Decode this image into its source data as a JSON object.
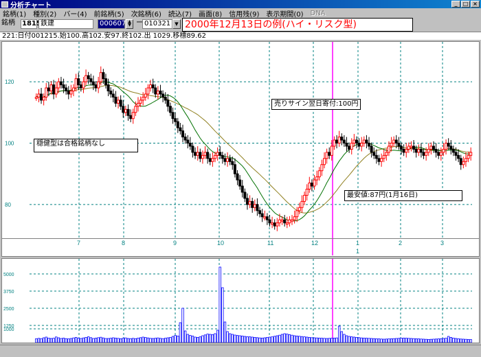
{
  "window": {
    "title": "分析チャート",
    "controls": {
      "minimize": "_",
      "maximize": "□",
      "close": "×"
    }
  },
  "menu": {
    "items": [
      "銘柄(1)",
      "種別(2)",
      "バー(4)",
      "前銘柄(5)",
      "次銘柄(6)",
      "読込(7)",
      "画面(8)",
      "信用残(9)",
      "表示期間(0)"
    ],
    "disabled_item": "DNA"
  },
  "toolbar": {
    "label": "銘柄",
    "code": "1815",
    "name": "鉄建",
    "start_date": "000607",
    "end_date": "010321",
    "separator": "ー"
  },
  "annotation_title": "2000年12月13日の例(ハイ・リスク型)",
  "info_line": "221:日付001215.始100.高102.安97.終102.出 1029.移標89.62",
  "colors": {
    "up_candle": "#ff0000",
    "down_candle": "#000000",
    "ma_short": "#007000",
    "ma_long": "#908020",
    "signal_line": "#ff40ff",
    "volume_bar": "#0000ff",
    "grid": "#008080"
  },
  "callouts": {
    "sell_signal": "売りサイン翌日寄付:100円",
    "stable_note": "穏健型は合格銘柄なし",
    "lowest_price": "最安値:87円(1月16日)"
  },
  "chart_data": {
    "type": "candlestick",
    "price_axis": {
      "ticks": [
        120,
        100,
        80
      ],
      "ylim": [
        69,
        133
      ]
    },
    "volume_axis": {
      "ticks": [
        5000,
        3750,
        2500,
        1250,
        1000
      ],
      "ylim": [
        0,
        6000
      ]
    },
    "month_labels": [
      "7",
      "8",
      "9",
      "10",
      "11",
      "12",
      "1",
      "2",
      "3"
    ],
    "year_marker": {
      "label": "1",
      "under": "1"
    },
    "signal_date": "001215",
    "closes": [
      115,
      116,
      114,
      115,
      118,
      117,
      119,
      116,
      118,
      120,
      119,
      118,
      117,
      116,
      117,
      118,
      121,
      119,
      118,
      120,
      122,
      121,
      120,
      119,
      118,
      120,
      123,
      121,
      119,
      117,
      116,
      115,
      113,
      114,
      112,
      110,
      111,
      109,
      108,
      110,
      112,
      113,
      114,
      115,
      116,
      118,
      119,
      118,
      116,
      117,
      116,
      115,
      114,
      112,
      110,
      108,
      107,
      105,
      104,
      102,
      101,
      100,
      99,
      97,
      96,
      97,
      95,
      96,
      97,
      95,
      94,
      95,
      96,
      97,
      96,
      95,
      94,
      95,
      94,
      93,
      90,
      88,
      86,
      84,
      82,
      80,
      81,
      79,
      80,
      78,
      77,
      76,
      76,
      75,
      74,
      74,
      73,
      74,
      75,
      75,
      74,
      74,
      75,
      75,
      76,
      78,
      79,
      81,
      83,
      85,
      87,
      86,
      88,
      89,
      91,
      93,
      95,
      97,
      96,
      99,
      101,
      100,
      102,
      101,
      100,
      99,
      98,
      100,
      101,
      100,
      99,
      100,
      101,
      100,
      99,
      97,
      96,
      95,
      94,
      95,
      96,
      97,
      99,
      100,
      101,
      100,
      99,
      98,
      97,
      98,
      99,
      99,
      98,
      97,
      98,
      97,
      96,
      97,
      98,
      99,
      98,
      97,
      96,
      97,
      98,
      100,
      99,
      98,
      97,
      96,
      95,
      93,
      94,
      95,
      96,
      97
    ],
    "volumes": [
      280,
      310,
      290,
      350,
      400,
      330,
      300,
      320,
      410,
      350,
      300,
      330,
      290,
      270,
      300,
      340,
      380,
      320,
      300,
      340,
      380,
      420,
      360,
      300,
      330,
      360,
      390,
      340,
      300,
      300,
      320,
      350,
      330,
      310,
      280,
      320,
      340,
      300,
      290,
      310,
      290,
      330,
      360,
      400,
      370,
      340,
      310,
      300,
      320,
      340,
      310,
      290,
      320,
      350,
      380,
      450,
      520,
      480,
      1450,
      2500,
      850,
      600,
      520,
      480,
      400,
      380,
      420,
      500,
      560,
      620,
      600,
      580,
      650,
      900,
      5500,
      4000,
      1500,
      800,
      650,
      600,
      550,
      520,
      500,
      480,
      450,
      430,
      420,
      400,
      380,
      360,
      340,
      330,
      350,
      380,
      400,
      420,
      460,
      500,
      540,
      600,
      650,
      620,
      580,
      540,
      500,
      480,
      460,
      440,
      420,
      400,
      380,
      360,
      350,
      340,
      330,
      320,
      310,
      300,
      310,
      320,
      330,
      340,
      1200,
      800,
      600,
      500,
      450,
      420,
      400,
      380,
      360,
      340,
      330,
      320,
      310,
      300,
      290,
      280,
      270,
      260,
      250,
      260,
      270,
      280,
      290,
      300,
      310,
      320,
      330,
      320,
      310,
      300,
      290,
      280,
      270,
      260,
      250,
      240,
      230,
      240,
      250,
      260,
      270,
      280,
      300,
      320,
      450,
      380,
      330,
      300,
      280,
      260,
      250,
      240,
      230,
      220,
      230,
      240,
      250,
      260,
      270,
      280,
      290,
      300,
      310,
      280,
      260
    ]
  }
}
